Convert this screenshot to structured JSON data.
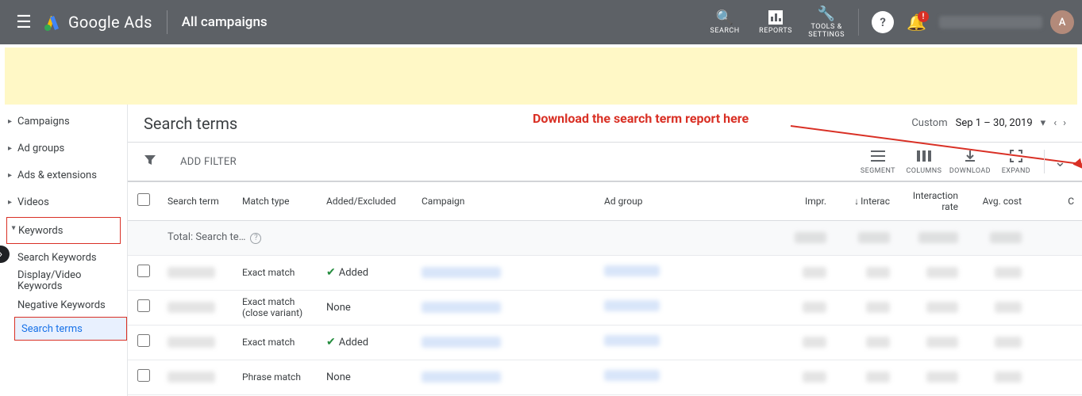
{
  "header": {
    "product": "Google Ads",
    "breadcrumb": "All campaigns",
    "search_label": "SEARCH",
    "reports_label": "REPORTS",
    "tools_label": "TOOLS & SETTINGS",
    "avatar_initial": "A"
  },
  "sidebar": {
    "items": [
      {
        "label": "Campaigns"
      },
      {
        "label": "Ad groups"
      },
      {
        "label": "Ads & extensions"
      },
      {
        "label": "Videos"
      },
      {
        "label": "Keywords"
      }
    ],
    "sub": {
      "search_kw": "Search Keywords",
      "dv_kw": "Display/Video Keywords",
      "neg_kw": "Negative Keywords",
      "search_terms": "Search terms"
    }
  },
  "page": {
    "title": "Search terms",
    "annotation": "Download the search term report here",
    "date_label": "Custom",
    "date_value": "Sep 1 – 30, 2019"
  },
  "filter": {
    "add_label": "ADD FILTER",
    "tools": {
      "segment": "SEGMENT",
      "columns": "COLUMNS",
      "download": "DOWNLOAD",
      "expand": "EXPAND"
    }
  },
  "table": {
    "columns": {
      "search_term": "Search term",
      "match_type": "Match type",
      "added_excluded": "Added/Excluded",
      "campaign": "Campaign",
      "ad_group": "Ad group",
      "impr": "Impr.",
      "interac": "Interac",
      "interaction_rate": "Interaction rate",
      "avg_cost": "Avg. cost"
    },
    "total_label": "Total: Search te…",
    "rows": [
      {
        "match": "Exact match",
        "added": "Added",
        "added_icon": true
      },
      {
        "match": "Exact match (close variant)",
        "added": "None",
        "added_icon": false
      },
      {
        "match": "Exact match",
        "added": "Added",
        "added_icon": true
      },
      {
        "match": "Phrase match",
        "added": "None",
        "added_icon": false
      }
    ]
  }
}
